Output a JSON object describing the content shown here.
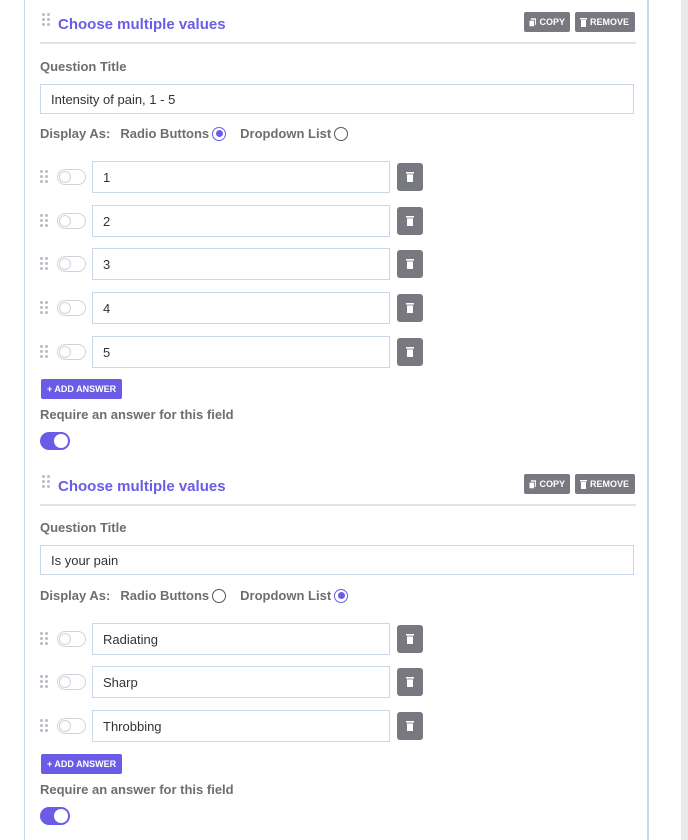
{
  "sections": [
    {
      "title": "Choose multiple values",
      "copy_label": "COPY",
      "remove_label": "REMOVE",
      "question_title_label": "Question Title",
      "question_title_value": "Intensity of pain, 1 - 5",
      "display_as_label": "Display As:",
      "display_options": [
        {
          "label": "Radio Buttons",
          "selected": true
        },
        {
          "label": "Dropdown List",
          "selected": false
        }
      ],
      "answers": [
        "1",
        "2",
        "3",
        "4",
        "5"
      ],
      "add_answer_label": "+ ADD ANSWER",
      "require_label": "Require an answer for this field",
      "require_enabled": true
    },
    {
      "title": "Choose multiple values",
      "copy_label": "COPY",
      "remove_label": "REMOVE",
      "question_title_label": "Question Title",
      "question_title_value": "Is your pain",
      "display_as_label": "Display As:",
      "display_options": [
        {
          "label": "Radio Buttons",
          "selected": false
        },
        {
          "label": "Dropdown List",
          "selected": true
        }
      ],
      "answers": [
        "Radiating",
        "Sharp",
        "Throbbing"
      ],
      "add_answer_label": "+ ADD ANSWER",
      "require_label": "Require an answer for this field",
      "require_enabled": true
    }
  ],
  "colors": {
    "accent": "#6b5ce7",
    "button_gray": "#787880",
    "border": "#c9d7ea"
  }
}
